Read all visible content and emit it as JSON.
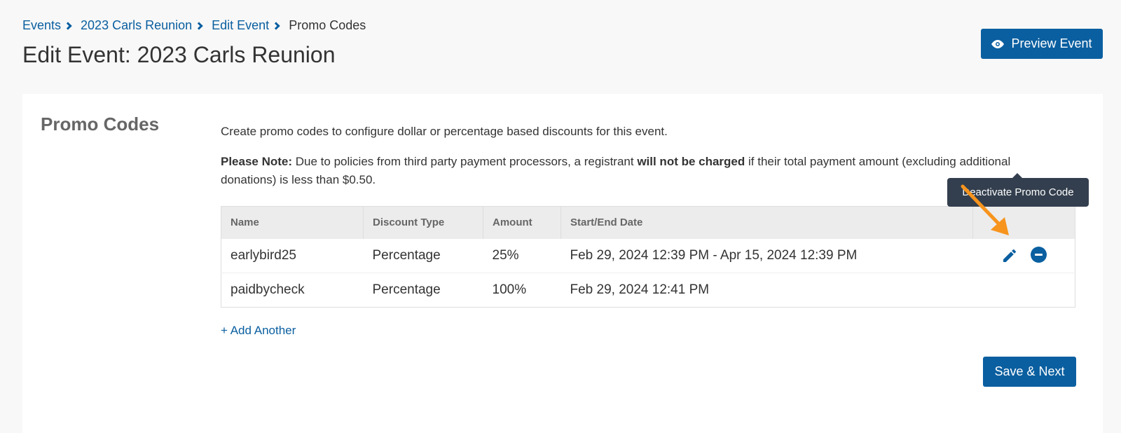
{
  "breadcrumb": {
    "items": [
      "Events",
      "2023 Carls Reunion",
      "Edit Event"
    ],
    "current": "Promo Codes"
  },
  "header": {
    "title": "Edit Event: 2023 Carls Reunion",
    "preview_label": "Preview Event"
  },
  "section": {
    "title": "Promo Codes",
    "intro": "Create promo codes to configure dollar or percentage based discounts for this event.",
    "note": {
      "label": "Please Note:",
      "text1": " Due to policies from third party payment processors, a registrant ",
      "emphasis": "will not be charged",
      "text2": " if their total payment amount (excluding additional donations) is less than $0.50."
    }
  },
  "table": {
    "columns": [
      "Name",
      "Discount Type",
      "Amount",
      "Start/End Date",
      ""
    ],
    "rows": [
      {
        "name": "earlybird25",
        "type": "Percentage",
        "amount": "25%",
        "dates": "Feb 29, 2024 12:39 PM - Apr 15, 2024 12:39 PM"
      },
      {
        "name": "paidbycheck",
        "type": "Percentage",
        "amount": "100%",
        "dates": "Feb 29, 2024 12:41 PM"
      }
    ]
  },
  "tooltip": "Deactivate Promo Code",
  "add_another": "+ Add Another",
  "save_label": "Save & Next",
  "icons": {
    "preview": "eye-icon",
    "edit": "pencil-icon",
    "deactivate": "minus-circle-icon",
    "annotation": "orange-arrow"
  },
  "colors": {
    "accent": "#0a5fa0",
    "tooltip_bg": "#333f4e",
    "annotation_arrow": "#f7941d"
  }
}
